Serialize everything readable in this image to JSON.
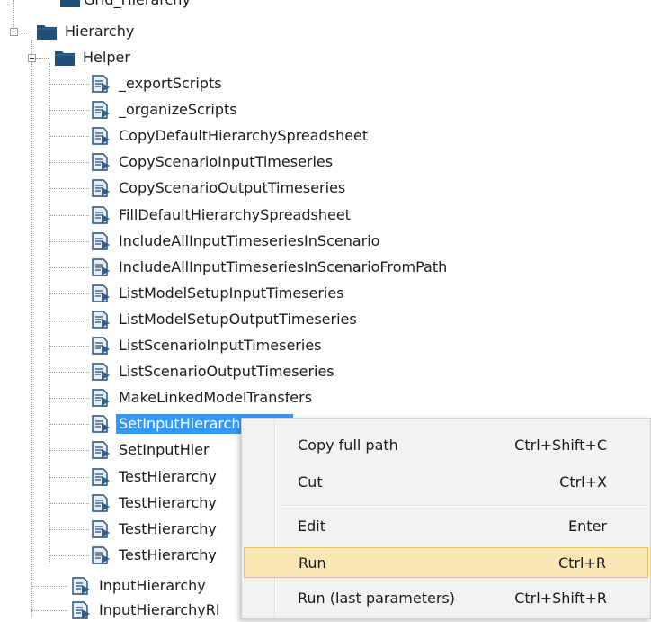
{
  "tree": {
    "partial_top_label": "Grid_Hierarchy",
    "hierarchy_folder": "Hierarchy",
    "helper_folder": "Helper",
    "helper_items": [
      "_exportScripts",
      "_organizeScripts",
      "CopyDefaultHierarchySpreadsheet",
      "CopyScenarioInputTimeseries",
      "CopyScenarioOutputTimeseries",
      "FillDefaultHierarchySpreadsheet",
      "IncludeAllInputTimeseriesInScenario",
      "IncludeAllInputTimeseriesInScenarioFromPath",
      "ListModelSetupInputTimeseries",
      "ListModelSetupOutputTimeseries",
      "ListScenarioInputTimeseries",
      "ListScenarioOutputTimeseries",
      "MakeLinkedModelTransfers",
      "SetInputHierarchyScript",
      "SetInputHier",
      "TestHierarchy",
      "TestHierarchy",
      "TestHierarchy",
      "TestHierarchy"
    ],
    "selected_index": 13,
    "root_items": [
      "InputHierarchy",
      "InputHierarchyRI"
    ]
  },
  "context_menu": {
    "items": [
      {
        "label": "Copy full path",
        "shortcut": "Ctrl+Shift+C"
      },
      {
        "label": "Cut",
        "shortcut": "Ctrl+X"
      },
      {
        "label": "Edit",
        "shortcut": "Enter"
      },
      {
        "label": "Run",
        "shortcut": "Ctrl+R"
      },
      {
        "label": "Run (last parameters)",
        "shortcut": "Ctrl+Shift+R"
      }
    ],
    "hovered_index": 3
  },
  "colors": {
    "selection": "#3399ff",
    "folder": "#1f4e79",
    "menu_hover": "#fbe7b5",
    "menu_hover_border": "#f0c14f"
  },
  "icons": {
    "folder": "folder-icon",
    "script": "script-icon",
    "expander": "collapse-icon"
  }
}
